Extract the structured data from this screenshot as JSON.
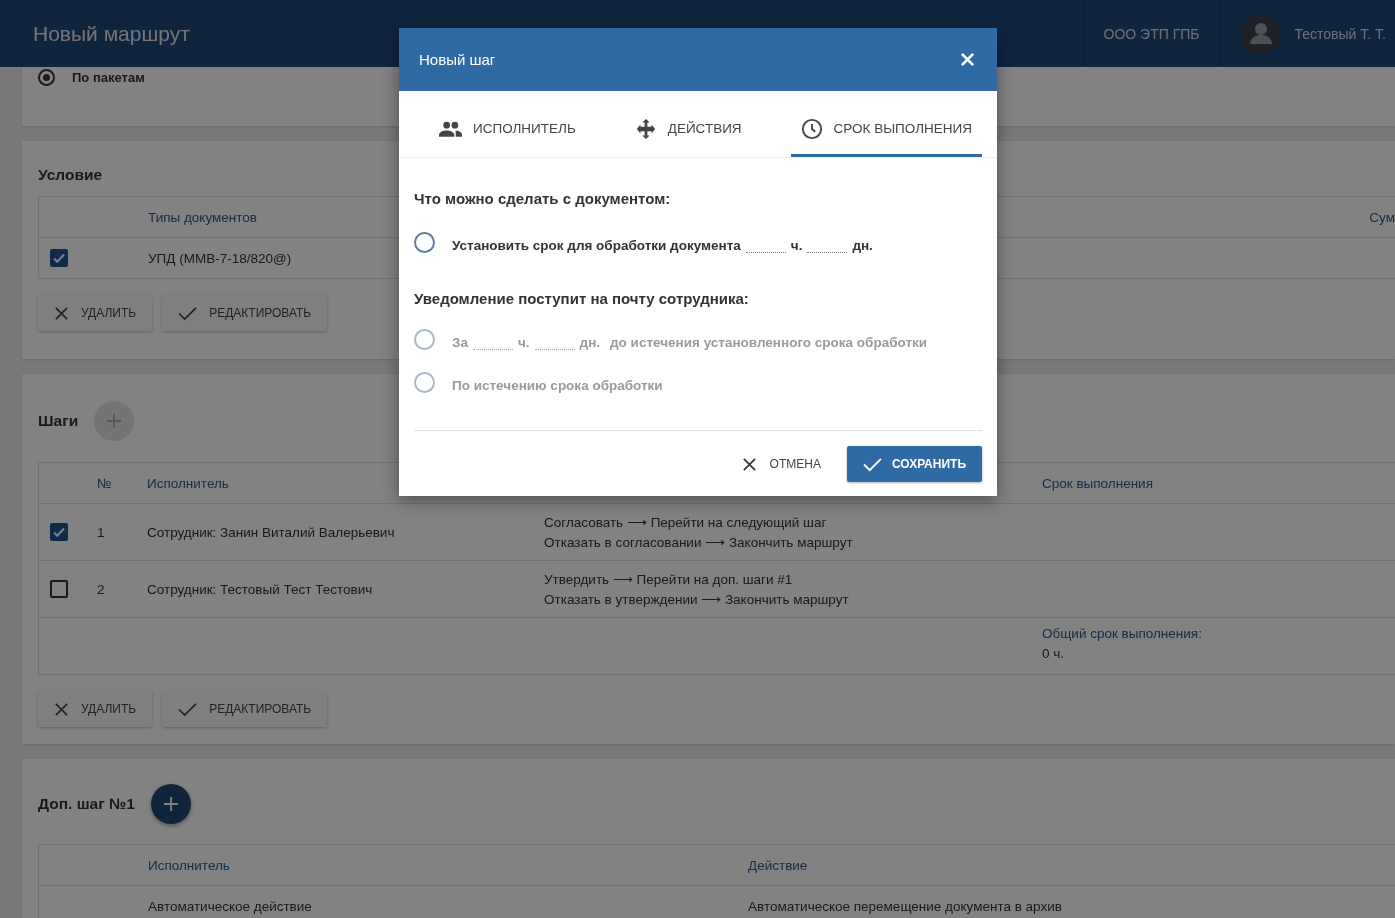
{
  "header": {
    "title": "Новый маршрут",
    "org": "ООО ЭТП ГПБ",
    "user": "Тестовый Т. Т."
  },
  "route_mode": {
    "label": "По пакетам",
    "selected": true
  },
  "condition": {
    "title": "Условие",
    "columns": [
      "Типы документов",
      "Сум"
    ],
    "rows": [
      {
        "checked": true,
        "type": "УПД (ММВ-7-18/820@)"
      }
    ],
    "buttons": [
      {
        "kind": "delete",
        "label": "УДАЛИТЬ"
      },
      {
        "kind": "edit",
        "label": "РЕДАКТИРОВАТЬ"
      }
    ]
  },
  "steps": {
    "title": "Шаги",
    "add_enabled": false,
    "columns": {
      "number": "№",
      "executor": "Исполнитель",
      "deadline": "Срок выполнения"
    },
    "rows": [
      {
        "checked": true,
        "number": "1",
        "executor": "Сотрудник: Занин Виталий Валерьевич",
        "actions": [
          "Согласовать ⟶ Перейти на следующий шаг",
          "Отказать в согласовании ⟶ Закончить маршрут"
        ]
      },
      {
        "checked": false,
        "number": "2",
        "executor": "Сотрудник: Тестовый Тест Тестович",
        "actions": [
          "Утвердить ⟶ Перейти на доп. шаги #1",
          "Отказать в утверждении ⟶ Закончить маршрут"
        ]
      }
    ],
    "total_label": "Общий срок выполнения:",
    "total_value": "0 ч.",
    "buttons": [
      {
        "kind": "delete",
        "label": "УДАЛИТЬ"
      },
      {
        "kind": "edit",
        "label": "РЕДАКТИРОВАТЬ"
      }
    ]
  },
  "extra_step": {
    "title": "Доп. шаг №1",
    "add_enabled": true,
    "columns": [
      "Исполнитель",
      "Действие"
    ],
    "rows": [
      {
        "executor": "Автоматическое действие",
        "action": "Автоматическое перемещение документа в архив"
      }
    ]
  },
  "modal": {
    "title": "Новый шаг",
    "tabs": [
      {
        "kind": "people",
        "label": "ИСПОЛНИТЕЛЬ",
        "selected": false
      },
      {
        "kind": "move",
        "label": "ДЕЙСТВИЯ",
        "selected": false
      },
      {
        "kind": "clock",
        "label": "СРОК ВЫПОЛНЕНИЯ",
        "selected": true
      }
    ],
    "section1_title": "Что можно сделать с документом:",
    "deadline_option": {
      "label": "Установить срок для обработки документа",
      "hours_unit": "ч.",
      "days_unit": "дн.",
      "selected": false,
      "disabled": false
    },
    "section2_title": "Уведомление поступит на почту сотрудника:",
    "notify_options": [
      {
        "kind": "before",
        "prefix": "За",
        "hours_unit": "ч.",
        "days_unit": "дн.",
        "suffix": "до истечения установленного срока обработки",
        "selected": false,
        "disabled": true
      },
      {
        "kind": "after",
        "label": "По истечению срока обработки",
        "selected": false,
        "disabled": true
      }
    ],
    "cancel": "ОТМЕНА",
    "save": "СОХРАНИТЬ"
  }
}
